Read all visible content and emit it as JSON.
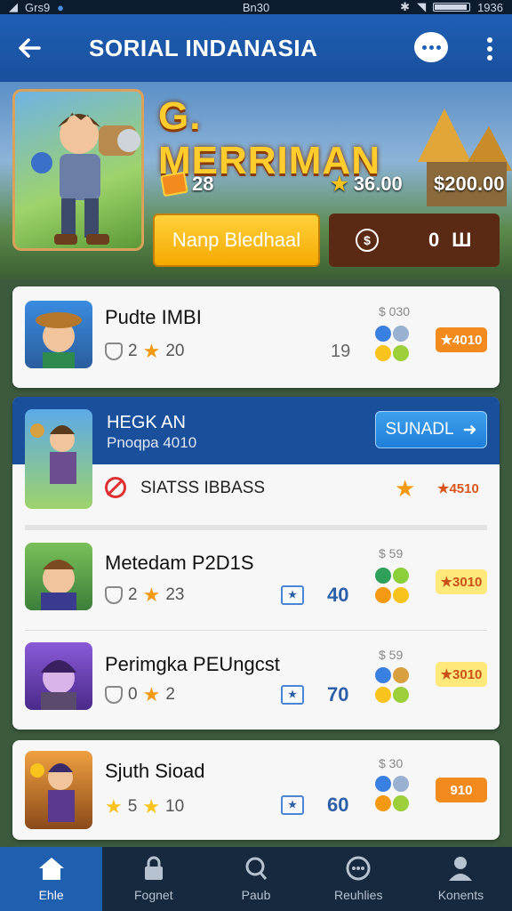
{
  "status": {
    "left": "Grs9",
    "time": "Bn30",
    "right": "1936"
  },
  "appbar": {
    "title": "SORIAL INDANASIA"
  },
  "hero": {
    "title": "G. MERRIMAN",
    "stat1": "28",
    "stat2": "36.00",
    "stat3": "$200.00",
    "button_label": "Nanp Bledhaal",
    "box_value": "0"
  },
  "items": [
    {
      "title": "Pudte IMBI",
      "small": "$ 030",
      "a": "2",
      "b": "20",
      "mid": "19",
      "badge": "4010",
      "badge_style": "orange"
    },
    {
      "title": "Metedam P2D1S",
      "small": "$ 59",
      "a": "2",
      "b": "23",
      "mid": "40",
      "badge": "3010",
      "badge_style": "yellow"
    },
    {
      "title": "Perimgka PEUngcst",
      "small": "$ 59",
      "a": "0",
      "b": "2",
      "mid": "70",
      "badge": "3010",
      "badge_style": "yellow"
    },
    {
      "title": "Sjuth Sioad",
      "small": "$ 30",
      "a": "5",
      "b": "10",
      "mid": "60",
      "badge": "910",
      "badge_style": "orange"
    }
  ],
  "featured": {
    "title": "HEGK AN",
    "subtitle": "Pnoqpa 4010",
    "button_label": "SUNADL",
    "row_label": "SIATSS IBBASS",
    "row_badge": "4510"
  },
  "nav": [
    {
      "label": "Ehle",
      "icon": "home-icon"
    },
    {
      "label": "Fognet",
      "icon": "lock-icon"
    },
    {
      "label": "Paub",
      "icon": "search-icon"
    },
    {
      "label": "Reuhlies",
      "icon": "chat-icon"
    },
    {
      "label": "Konents",
      "icon": "person-icon"
    }
  ],
  "colors": {
    "appbar": "#1e5fb4",
    "accent_gold": "#ffcc2e",
    "orange_badge": "#f28a1e",
    "nav_bg": "#16293f"
  }
}
